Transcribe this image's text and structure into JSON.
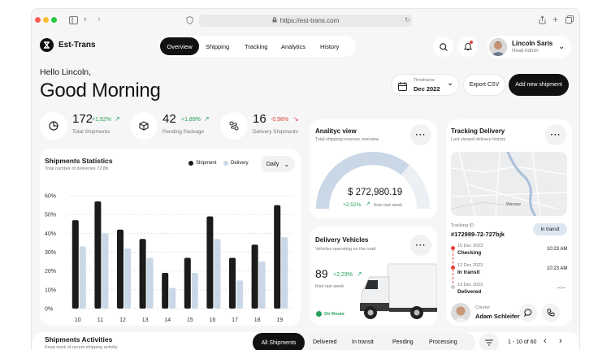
{
  "browser": {
    "url": "https://est-trans.com"
  },
  "app": {
    "name": "Est-Trans"
  },
  "nav": {
    "tabs": [
      "Overview",
      "Shipping",
      "Tracking",
      "Analytics",
      "History"
    ],
    "active": "Overview"
  },
  "user": {
    "name": "Lincoln Saris",
    "role": "Head Admin"
  },
  "greeting": {
    "hello": "Hello Lincoln,",
    "title": "Good Morning"
  },
  "timeframe": {
    "label": "Timeframe",
    "value": "Dec 2022"
  },
  "actions": {
    "export": "Export CSV",
    "add": "Add new shipment"
  },
  "stats": [
    {
      "value": "172",
      "change": "+1,92%",
      "label": "Total Shipments",
      "trend": "up"
    },
    {
      "value": "42",
      "change": "+1,89%",
      "label": "Pending Package",
      "trend": "up"
    },
    {
      "value": "16",
      "change": "-0,98%",
      "label": "Delivery Shipments",
      "trend": "down"
    }
  ],
  "shipments_chart": {
    "title": "Shipments Statistics",
    "subtitle": "Total number of deliveries 72.8K",
    "legend": [
      "Shipment",
      "Delivery"
    ],
    "period": "Daily",
    "yticks": [
      "60%",
      "50%",
      "40%",
      "30%",
      "20%",
      "10%",
      "0%"
    ]
  },
  "chart_data": {
    "type": "bar",
    "categories": [
      "10",
      "11",
      "12",
      "13",
      "14",
      "15",
      "16",
      "17",
      "18",
      "19"
    ],
    "series": [
      {
        "name": "Shipment",
        "values": [
          47,
          57,
          42,
          37,
          19,
          27,
          49,
          27,
          34,
          55
        ]
      },
      {
        "name": "Delivery",
        "values": [
          33,
          40,
          32,
          27,
          11,
          19,
          37,
          15,
          25,
          38
        ]
      }
    ],
    "ylim": [
      0,
      60
    ],
    "colors": {
      "Shipment": "#1b1b1b",
      "Delivery": "#c9d7e6"
    }
  },
  "analytic": {
    "title": "Analityc view",
    "subtitle": "Total shipping revenue overview",
    "value": "$ 272,980.19",
    "change": "+2,52%",
    "since": "than last week",
    "gauge_fraction": 0.72
  },
  "vehicles": {
    "title": "Delivery Vehicles",
    "subtitle": "Vehicles operating on the road",
    "value": "89",
    "change": "+2,29%",
    "since": "than last week",
    "status": "On Route"
  },
  "tracking": {
    "title": "Tracking Delivery",
    "subtitle": "Last viewed delivery history",
    "id_label": "Tracking ID",
    "id": "#172989-72-727bjk",
    "status": "In transit",
    "map_label": "Warsaw",
    "events": [
      {
        "date": "15 Dec 2023",
        "status": "Checking",
        "time": "10:23 AM"
      },
      {
        "date": "12 Dec 2023",
        "status": "In transit",
        "time": "10:23 AM"
      },
      {
        "date": "13 Dec 2023",
        "status": "Delivered",
        "time": "--:--"
      }
    ],
    "courier_label": "Courier",
    "courier_name": "Adam Schleifer"
  },
  "activities": {
    "title": "Shipments Activities",
    "subtitle": "Keep track of recent shipping activity",
    "filters": [
      "All Shipments",
      "Delivered",
      "In transit",
      "Pending",
      "Processing"
    ],
    "active": "All Shipments",
    "pagination": "1 - 10 of 60"
  },
  "colors": {
    "accent": "#111111",
    "green": "#22a05a",
    "red": "#e0433a",
    "gauge": "#c9d7e6"
  }
}
